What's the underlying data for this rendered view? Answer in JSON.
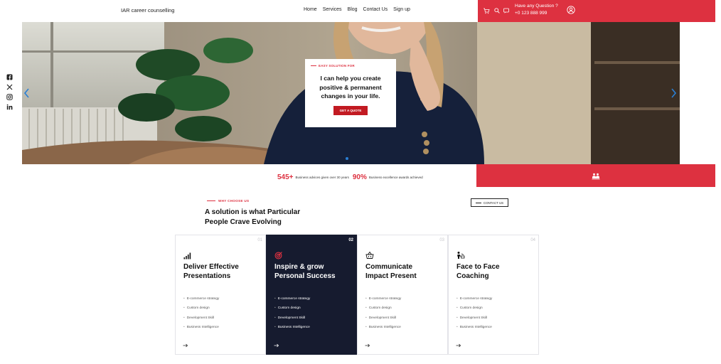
{
  "header": {
    "brand": "IAR career counselling",
    "nav": [
      "Home",
      "Services",
      "Blog",
      "Contact Us",
      "Sign up"
    ],
    "question_label": "Have any Question ?",
    "phone": "+0 123 888 999"
  },
  "icons": {
    "cart": "cart-icon",
    "search": "search-icon",
    "chat": "chat-icon",
    "user": "user-circle-icon"
  },
  "social": [
    "facebook-icon",
    "x-icon",
    "instagram-icon",
    "linkedin-icon"
  ],
  "hero": {
    "eyebrow": "EASY SOLUTION FOR",
    "title": "I can help you create positive & permanent changes in your life.",
    "button": "GET A QUOTE",
    "slide_index": 1
  },
  "stats": [
    {
      "value": "545+",
      "label": "Business advices given over 30 years"
    },
    {
      "value": "90%",
      "label": "Business excellence awards achieved"
    }
  ],
  "why": {
    "eyebrow": "WHY CHOOSE US",
    "heading_line1": "A solution is what Particular",
    "heading_line2": "People Crave Evolving",
    "contact_button": "CONTACT US"
  },
  "services": [
    {
      "num": "01",
      "title_line1": "Deliver Effective",
      "title_line2": "Presentations",
      "icon": "signal-bars-icon",
      "items": [
        "E-commerce strategy",
        "Custom design",
        "Development Skill",
        "Business Intelligence"
      ]
    },
    {
      "num": "02",
      "title_line1": "Inspire & grow",
      "title_line2": "Personal Success",
      "icon": "target-icon",
      "items": [
        "E-commerce strategy",
        "Custom design",
        "Development Skill",
        "Business Intelligence"
      ]
    },
    {
      "num": "03",
      "title_line1": "Communicate",
      "title_line2": "Impact Present",
      "icon": "basket-icon",
      "items": [
        "E-commerce strategy",
        "Custom design",
        "Development Skill",
        "Business Intelligence"
      ]
    },
    {
      "num": "04",
      "title_line1": "Face to Face",
      "title_line2": "Coaching",
      "icon": "coaching-icon",
      "items": [
        "E-commerce strategy",
        "Custom design",
        "Development Skill",
        "Business Intelligence"
      ]
    }
  ],
  "colors": {
    "accent": "#dd3140",
    "button": "#c21a22",
    "dark_card": "#161b2f",
    "slider_arrow": "#2a7fd4"
  }
}
